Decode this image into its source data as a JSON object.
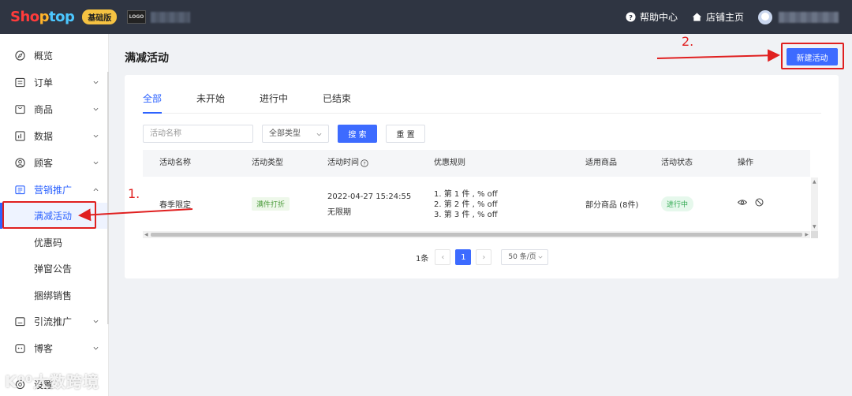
{
  "header": {
    "brand": {
      "part1": "Sho",
      "part2": "p",
      "part3": "top"
    },
    "plan_badge": "基础版",
    "store_logo_text": "LOGO",
    "help_label": "帮助中心",
    "store_home_label": "店铺主页"
  },
  "sidebar": {
    "items": [
      {
        "label": "概览",
        "icon": "compass-icon",
        "expandable": false
      },
      {
        "label": "订单",
        "icon": "order-icon",
        "expandable": true
      },
      {
        "label": "商品",
        "icon": "product-icon",
        "expandable": true
      },
      {
        "label": "数据",
        "icon": "data-chart-icon",
        "expandable": true
      },
      {
        "label": "顾客",
        "icon": "user-icon",
        "expandable": true
      },
      {
        "label": "营销推广",
        "icon": "marketing-icon",
        "expandable": true,
        "expanded": true
      },
      {
        "label": "满减活动",
        "sub": true,
        "active": true
      },
      {
        "label": "优惠码",
        "sub": true
      },
      {
        "label": "弹窗公告",
        "sub": true
      },
      {
        "label": "捆绑销售",
        "sub": true
      },
      {
        "label": "引流推广",
        "icon": "traffic-icon",
        "expandable": true
      },
      {
        "label": "博客",
        "icon": "blog-icon",
        "expandable": true
      },
      {
        "label": "设置",
        "icon": "settings-icon",
        "expandable": false
      }
    ]
  },
  "main": {
    "title": "满减活动",
    "new_button": "新建活动",
    "tabs": [
      {
        "label": "全部",
        "active": true
      },
      {
        "label": "未开始"
      },
      {
        "label": "进行中"
      },
      {
        "label": "已结束"
      }
    ],
    "filter": {
      "name_placeholder": "活动名称",
      "type_select": "全部类型",
      "search_button": "搜 索",
      "reset_button": "重 置"
    },
    "table": {
      "columns": [
        "活动名称",
        "活动类型",
        "活动时间",
        "优惠规则",
        "适用商品",
        "活动状态",
        "操作"
      ],
      "rows": [
        {
          "name": "春季限定",
          "type": "满件打折",
          "time_start": "2022-04-27 15:24:55",
          "time_end": "无限期",
          "rules": [
            "1. 第 1 件 , % off",
            "2. 第 2 件 , % off",
            "3. 第 3 件 , % off"
          ],
          "products": "部分商品 (8件)",
          "status": "进行中"
        }
      ]
    },
    "pagination": {
      "total": "1条",
      "current_page": "1",
      "page_size": "50 条/页"
    }
  },
  "annotations": {
    "step1": "1.",
    "step2": "2."
  },
  "watermark": "K⁰⁰大数跨境",
  "colors": {
    "primary": "#3d6bff",
    "header_bg": "#2f3542",
    "annotation": "#e02020",
    "status_green": "#2fa84f"
  }
}
